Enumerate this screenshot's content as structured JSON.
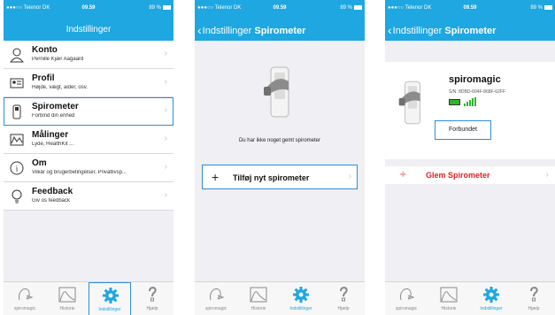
{
  "status_bar": {
    "carrier": "●●●○○ Telenor DK",
    "time": "09.59",
    "battery": "89 %"
  },
  "screen1": {
    "title": "Indstillinger",
    "items": [
      {
        "title": "Konto",
        "subtitle": "Pernille Kjær Aagaard",
        "icon": "person-icon"
      },
      {
        "title": "Profil",
        "subtitle": "Højde, vægt, alder, osv.",
        "icon": "id-card-icon"
      },
      {
        "title": "Spirometer",
        "subtitle": "Forbind din enhed",
        "icon": "spirometer-icon"
      },
      {
        "title": "Målinger",
        "subtitle": "Lyde, HealthKit ...",
        "icon": "graph-icon"
      },
      {
        "title": "Om",
        "subtitle": "Vilkår og brugerbetingelser, Privatlivsp...",
        "icon": "info-icon"
      },
      {
        "title": "Feedback",
        "subtitle": "Giv os feedback",
        "icon": "bulb-icon"
      }
    ]
  },
  "screen2": {
    "back_label": "Indstillinger",
    "title": "Spirometer",
    "empty_message": "Du har ikke noget gemt spirometer",
    "add_label": "Tilføj nyt spirometer"
  },
  "screen3": {
    "back_label": "Indstillinger",
    "title": "Spirometer",
    "device_name": "spiromagic",
    "serial": "S/N: 8DBD-604F-868F-62FF",
    "connection_status": "Forbundet",
    "forget_label": "Glem Spirometer"
  },
  "tabs": [
    {
      "label": "spiromagic",
      "icon": "spiromagic-icon"
    },
    {
      "label": "Historie",
      "icon": "history-chart-icon"
    },
    {
      "label": "Indstillinger",
      "icon": "gear-icon"
    },
    {
      "label": "Hjælp",
      "icon": "help-icon"
    }
  ],
  "colors": {
    "nav_blue": "#1ea7e0",
    "select_blue": "#2e8ed6",
    "danger_red": "#e02020",
    "ok_green": "#2db52d"
  }
}
